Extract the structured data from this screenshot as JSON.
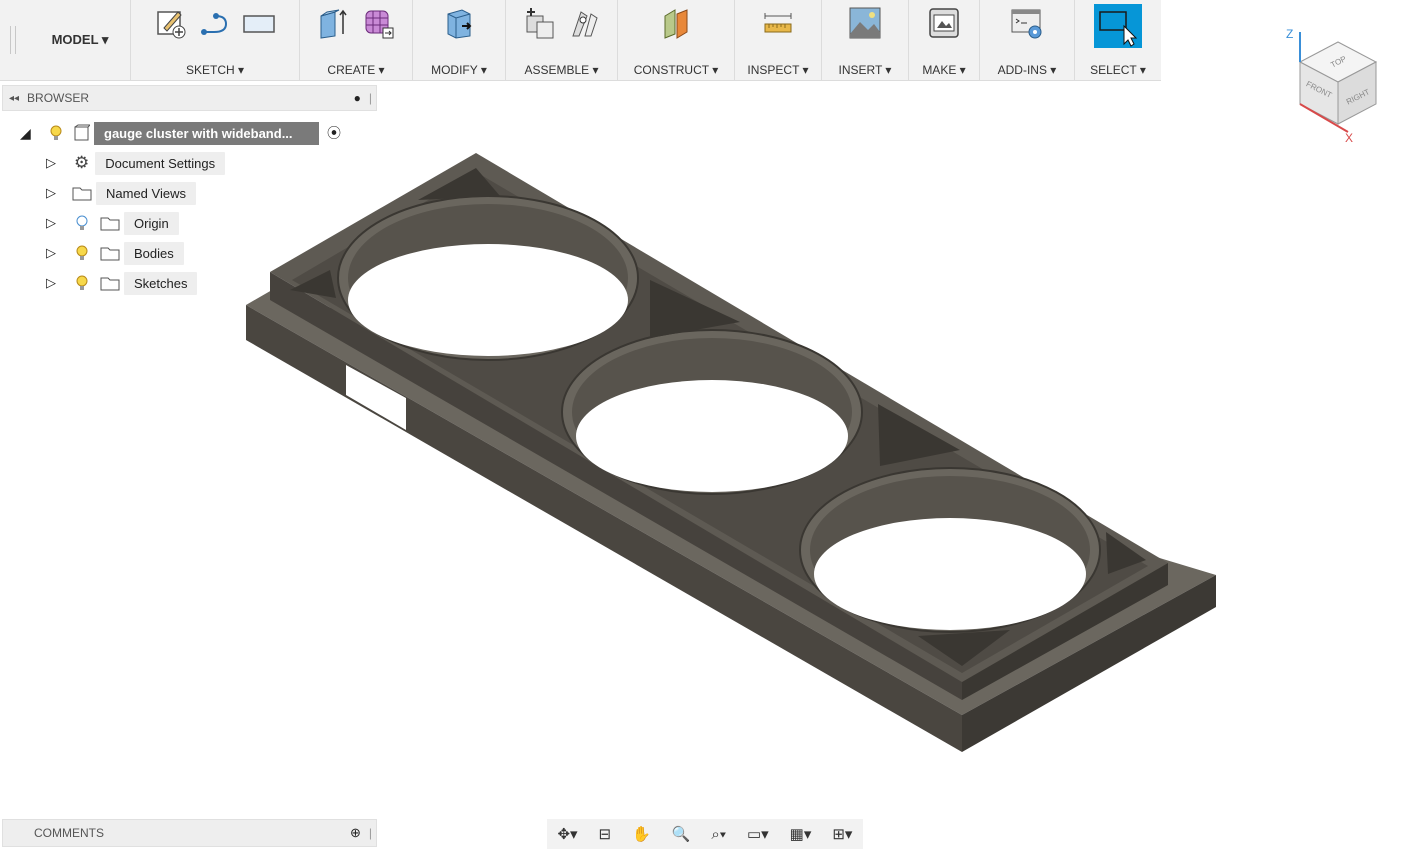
{
  "toolbar": {
    "model_label": "MODEL ▾",
    "groups": [
      {
        "label": "SKETCH ▾"
      },
      {
        "label": "CREATE ▾"
      },
      {
        "label": "MODIFY ▾"
      },
      {
        "label": "ASSEMBLE ▾"
      },
      {
        "label": "CONSTRUCT ▾"
      },
      {
        "label": "INSPECT ▾"
      },
      {
        "label": "INSERT ▾"
      },
      {
        "label": "MAKE ▾"
      },
      {
        "label": "ADD-INS ▾"
      },
      {
        "label": "SELECT ▾"
      }
    ]
  },
  "browser": {
    "title": "BROWSER",
    "root": "gauge cluster with wideband...",
    "items": [
      {
        "label": "Document Settings",
        "icon": "gear-icon"
      },
      {
        "label": "Named Views",
        "icon": "folder-icon"
      },
      {
        "label": "Origin",
        "icon": "folder-icon"
      },
      {
        "label": "Bodies",
        "icon": "folder-icon"
      },
      {
        "label": "Sketches",
        "icon": "folder-icon"
      }
    ]
  },
  "comments": {
    "title": "COMMENTS"
  },
  "viewcube": {
    "top": "TOP",
    "front": "FRONT",
    "right": "RIGHT",
    "axis_z": "Z",
    "axis_x": "X"
  },
  "colors": {
    "accent": "#0696d7",
    "model_body": "#5a5650",
    "toolbar_bg": "#f2f2f2"
  }
}
